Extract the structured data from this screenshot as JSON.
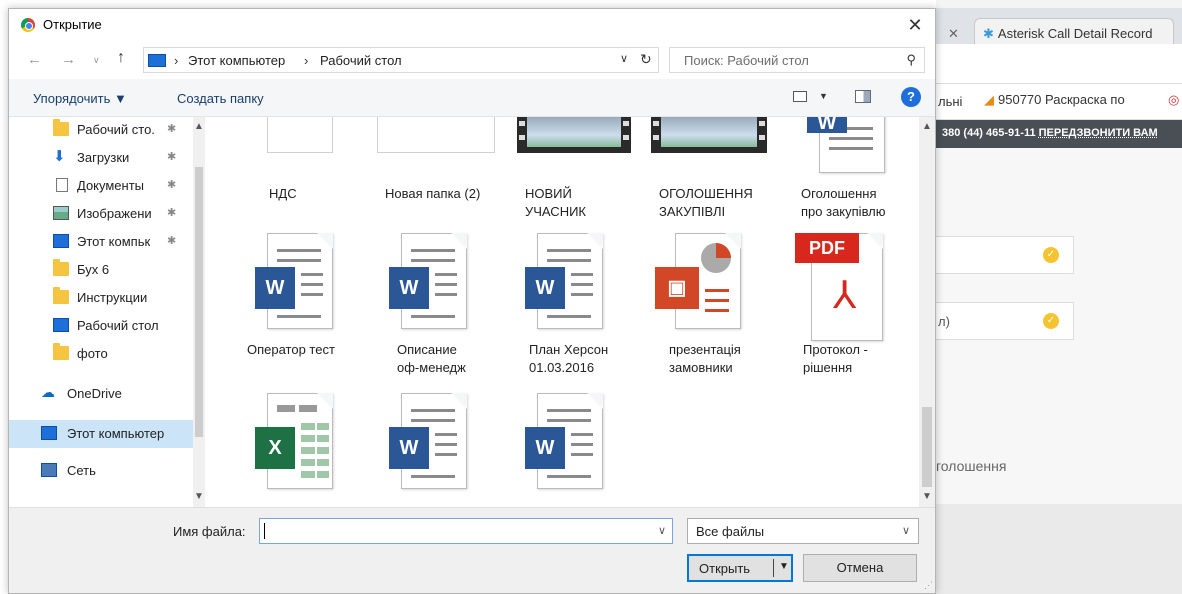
{
  "dialog": {
    "title": "Открытие",
    "breadcrumb": [
      "Этот компьютер",
      "Рабочий стол"
    ],
    "search_placeholder": "Поиск: Рабочий стол",
    "toolbar": {
      "organize": "Упорядочить ▼",
      "new_folder": "Создать папку",
      "help": "?"
    },
    "sidebar": [
      {
        "label": "Рабочий сто.",
        "icon": "folder-icon",
        "pinned": true
      },
      {
        "label": "Загрузки",
        "icon": "download-icon",
        "pinned": true
      },
      {
        "label": "Документы",
        "icon": "documents-icon",
        "pinned": true
      },
      {
        "label": "Изображени",
        "icon": "pictures-icon",
        "pinned": true
      },
      {
        "label": "Этот компьк",
        "icon": "computer-icon",
        "pinned": true
      },
      {
        "label": "Бух 6",
        "icon": "folder-icon",
        "pinned": false
      },
      {
        "label": "Инструкции",
        "icon": "folder-icon",
        "pinned": false
      },
      {
        "label": "Рабочий стол",
        "icon": "computer-icon",
        "pinned": false
      },
      {
        "label": "фото",
        "icon": "folder-icon",
        "pinned": false
      },
      {
        "label": "OneDrive",
        "icon": "onedrive-icon",
        "pinned": false
      },
      {
        "label": "Этот компьютер",
        "icon": "computer-icon",
        "pinned": false,
        "selected": true
      },
      {
        "label": "Сеть",
        "icon": "network-icon",
        "pinned": false
      }
    ],
    "files": [
      {
        "name": "НДС",
        "type": "blank"
      },
      {
        "name": "Новая папка (2)",
        "type": "blank"
      },
      {
        "name": "НОВИЙ\nУЧАСНИК",
        "type": "video"
      },
      {
        "name": "ОГОЛОШЕННЯ\nЗАКУПІВЛІ",
        "type": "video"
      },
      {
        "name": "Оголошення\nпро закупівлю",
        "type": "word"
      },
      {
        "name": "Оператор тест",
        "type": "word"
      },
      {
        "name": "Описание\nоф-менедж",
        "type": "word"
      },
      {
        "name": "План Херсон\n01.03.2016",
        "type": "word"
      },
      {
        "name": "презентація\nзамовники",
        "type": "powerpoint"
      },
      {
        "name": "Протокол -\nрішення",
        "type": "pdf"
      },
      {
        "name": "",
        "type": "excel"
      },
      {
        "name": "",
        "type": "word"
      },
      {
        "name": "",
        "type": "word"
      }
    ],
    "file_name_label": "Имя файла:",
    "file_name_value": "",
    "filter": "Все файлы",
    "open_label": "Открыть",
    "cancel_label": "Отмена"
  },
  "background": {
    "tab_title": "Asterisk Call Detail Record",
    "bookmark_partial": "льні",
    "bookmark": "950770 Раскраска по",
    "banner_phone": "380 (44) 465-91-11",
    "banner_cta": "ПЕРЕДЗВОНИТИ ВАМ",
    "field2_text": "л)",
    "section_label": "голошення"
  },
  "colors": {
    "accent": "#0078d7",
    "selection": "#cce4f7",
    "word": "#2b5797",
    "excel": "#1e7145",
    "powerpoint": "#d24726",
    "pdf": "#d8271c"
  }
}
